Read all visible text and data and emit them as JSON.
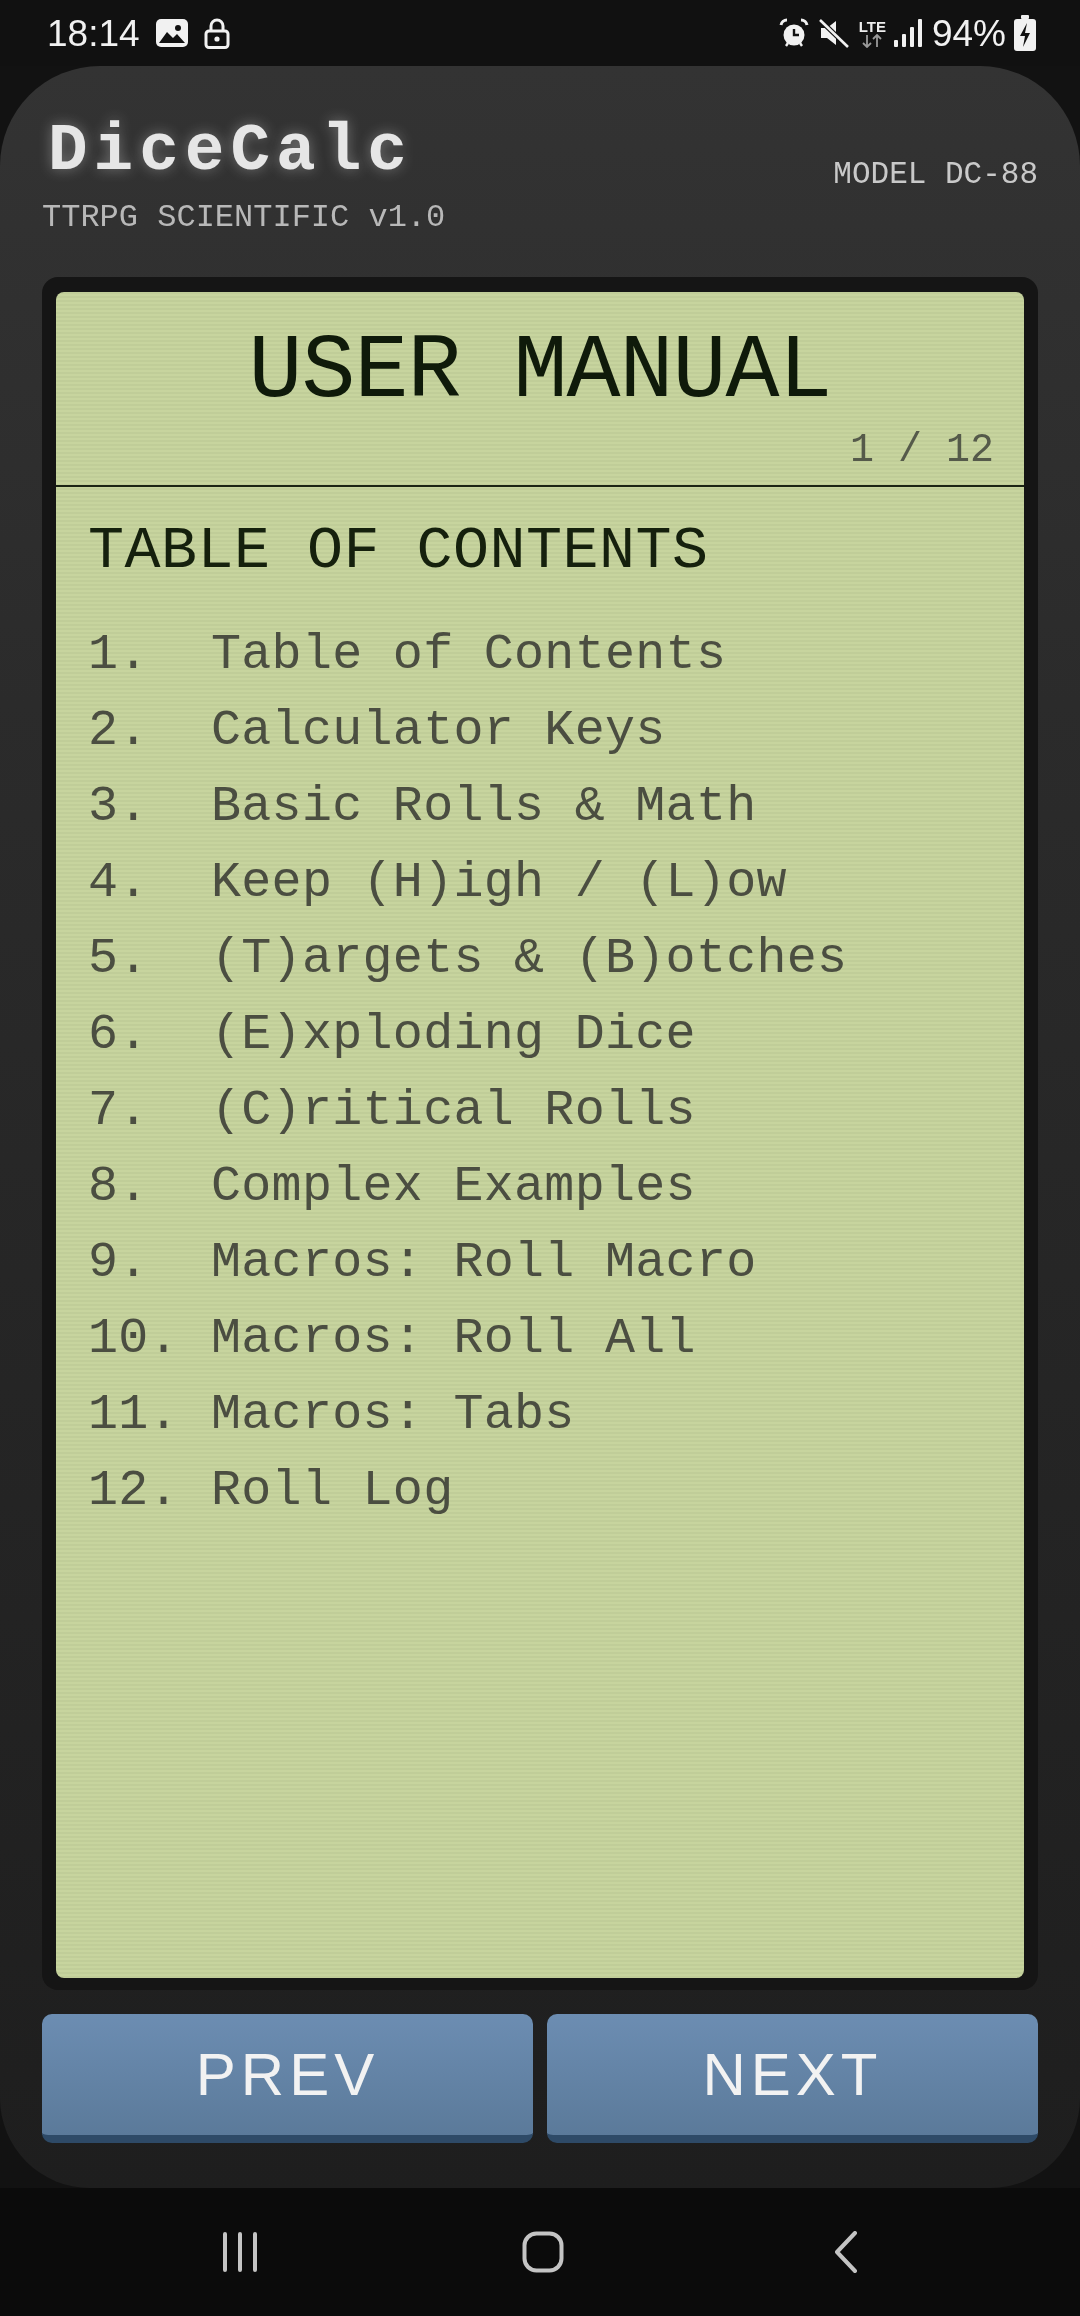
{
  "status_bar": {
    "time": "18:14",
    "network": "LTE",
    "battery": "94%"
  },
  "device": {
    "logo": "DiceCalc",
    "subtitle": "TTRPG SCIENTIFIC v1.0",
    "model": "MODEL DC-88"
  },
  "screen": {
    "title": "USER MANUAL",
    "page": "1 / 12",
    "heading": "TABLE OF CONTENTS",
    "entries": [
      {
        "number": "1.",
        "title": "Table of Contents"
      },
      {
        "number": "2.",
        "title": "Calculator Keys"
      },
      {
        "number": "3.",
        "title": "Basic Rolls & Math"
      },
      {
        "number": "4.",
        "title": "Keep (H)igh / (L)ow"
      },
      {
        "number": "5.",
        "title": "(T)argets & (B)otches"
      },
      {
        "number": "6.",
        "title": "(E)xploding Dice"
      },
      {
        "number": "7.",
        "title": "(C)ritical Rolls"
      },
      {
        "number": "8.",
        "title": "Complex Examples"
      },
      {
        "number": "9.",
        "title": "Macros: Roll Macro"
      },
      {
        "number": "10.",
        "title": "Macros: Roll All"
      },
      {
        "number": "11.",
        "title": "Macros: Tabs"
      },
      {
        "number": "12.",
        "title": "Roll Log"
      }
    ]
  },
  "buttons": [
    {
      "label": "PREV"
    },
    {
      "label": "NEXT"
    }
  ]
}
